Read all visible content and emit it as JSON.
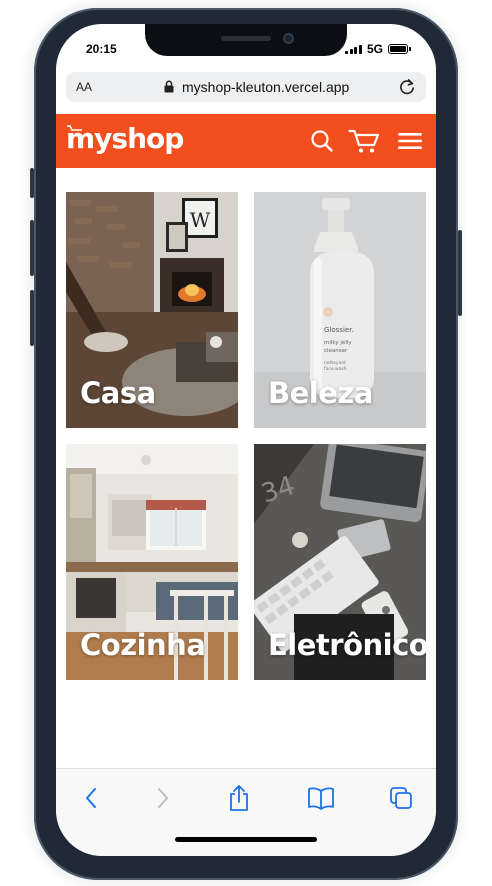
{
  "status": {
    "time": "20:15",
    "network": "5G"
  },
  "browser": {
    "text_size_label": "AA",
    "url": "myshop-kleuton.vercel.app"
  },
  "header": {
    "logo_text": "myshop",
    "brand_color": "#f24e1e",
    "icons": [
      "search-icon",
      "cart-icon",
      "menu-icon"
    ]
  },
  "categories": [
    {
      "label": "Casa"
    },
    {
      "label": "Beleza"
    },
    {
      "label": "Cozinha"
    },
    {
      "label": "Eletrônicos"
    }
  ],
  "toolbar": {
    "icons": [
      "back-icon",
      "forward-icon",
      "share-icon",
      "bookmarks-icon",
      "tabs-icon"
    ],
    "accent_color": "#1a73e8"
  }
}
